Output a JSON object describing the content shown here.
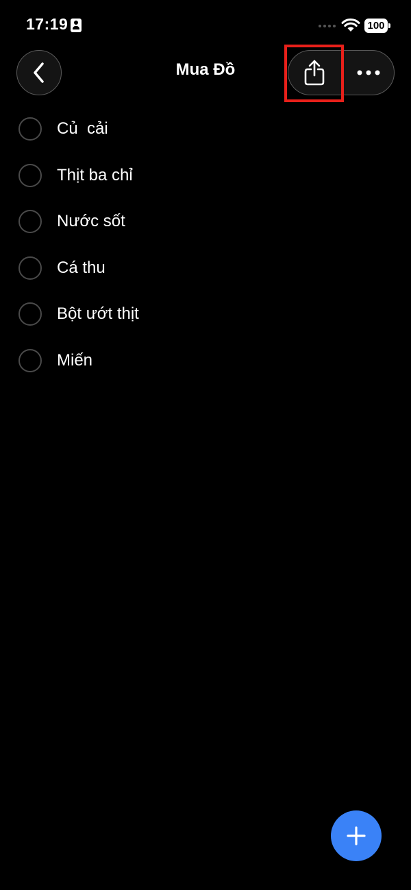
{
  "status_bar": {
    "time": "17:19",
    "battery": "100"
  },
  "nav": {
    "title": "Mua Đồ"
  },
  "icons": {
    "back": "chevron-left-icon",
    "share": "share-icon",
    "more": "ellipsis-icon",
    "add": "plus-icon",
    "wifi": "wifi-icon",
    "contact": "contact-card-icon"
  },
  "colors": {
    "background": "#000000",
    "accent": "#3a82f7",
    "highlight": "#e8201a"
  },
  "list": {
    "items": [
      {
        "label": "Củ  cải",
        "checked": false
      },
      {
        "label": "Thịt ba chỉ",
        "checked": false
      },
      {
        "label": "Nước sốt",
        "checked": false
      },
      {
        "label": "Cá thu",
        "checked": false
      },
      {
        "label": "Bột ướt thịt",
        "checked": false
      },
      {
        "label": "Miến",
        "checked": false
      }
    ]
  }
}
